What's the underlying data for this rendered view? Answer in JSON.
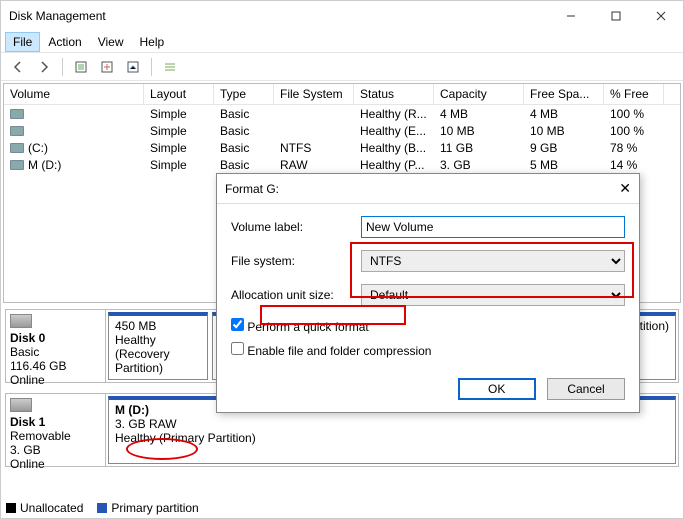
{
  "window": {
    "title": "Disk Management"
  },
  "menu": {
    "file": "File",
    "action": "Action",
    "view": "View",
    "help": "Help"
  },
  "columns": {
    "volume": "Volume",
    "layout": "Layout",
    "type": "Type",
    "fs": "File System",
    "status": "Status",
    "capacity": "Capacity",
    "free": "Free Spa...",
    "pct": "% Free"
  },
  "volumes": [
    {
      "name": "",
      "layout": "Simple",
      "type": "Basic",
      "fs": "",
      "status": "Healthy (R...",
      "cap": "4   MB",
      "free": "4   MB",
      "pct": "100 %"
    },
    {
      "name": "",
      "layout": "Simple",
      "type": "Basic",
      "fs": "",
      "status": "Healthy (E...",
      "cap": "10   MB",
      "free": "10   MB",
      "pct": "100 %"
    },
    {
      "name": "(C:)",
      "layout": "Simple",
      "type": "Basic",
      "fs": "NTFS",
      "status": "Healthy (B...",
      "cap": "11   GB",
      "free": "9   GB",
      "pct": "78 %"
    },
    {
      "name": "M (D:)",
      "layout": "Simple",
      "type": "Basic",
      "fs": "RAW",
      "status": "Healthy (P...",
      "cap": "3.   GB",
      "free": "5   MB",
      "pct": "14 %"
    }
  ],
  "disks": [
    {
      "label": "Disk 0",
      "kind": "Basic",
      "size": "116.46 GB",
      "state": "Online",
      "parts": [
        {
          "title": "",
          "line": "450 MB",
          "desc": "Healthy (Recovery Partition)"
        },
        {
          "title": "",
          "line": "",
          "desc": "mp, Primary Partition)"
        }
      ]
    },
    {
      "label": "Disk 1",
      "kind": "Removable",
      "size": "3.   GB",
      "state": "Online",
      "parts": [
        {
          "title": "M (D:)",
          "line": "3.   GB  RAW",
          "desc": "Healthy (Primary Partition)"
        }
      ]
    }
  ],
  "legend": {
    "unalloc": "Unallocated",
    "primary": "Primary partition"
  },
  "dialog": {
    "title": "Format G:",
    "volume_label_lab": "Volume label:",
    "volume_label_val": "New Volume",
    "fs_lab": "File system:",
    "fs_val": "NTFS",
    "au_lab": "Allocation unit size:",
    "au_val": "Default",
    "quick": "Perform a quick format",
    "compress": "Enable file and folder compression",
    "ok": "OK",
    "cancel": "Cancel"
  }
}
